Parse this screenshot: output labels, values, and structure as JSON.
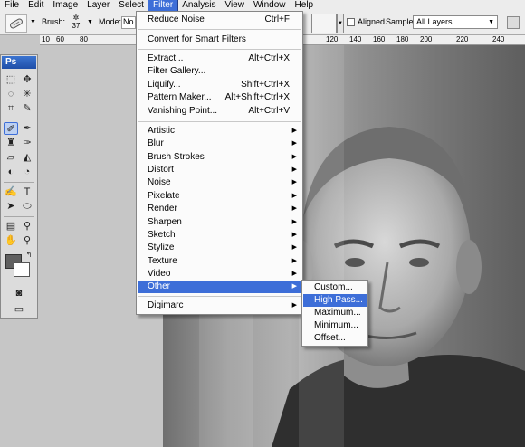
{
  "menubar": {
    "items": [
      "File",
      "Edit",
      "Image",
      "Layer",
      "Select",
      "Filter",
      "Analysis",
      "View",
      "Window",
      "Help"
    ],
    "active": "Filter"
  },
  "options": {
    "brush_label": "Brush:",
    "brush_size": "37",
    "mode_label": "Mode:",
    "mode_value": "No",
    "aligned_label": "Aligned",
    "sample_label": "Sample:",
    "sample_value": "All Layers"
  },
  "ruler": {
    "labels": [
      "10",
      "60",
      "80",
      "120",
      "140",
      "160",
      "180",
      "200",
      "220",
      "240"
    ]
  },
  "toolbox": {
    "logo": "Ps"
  },
  "filter_menu": {
    "top_items": [
      {
        "label": "Reduce Noise",
        "shortcut": "Ctrl+F"
      },
      {
        "label": "Convert for Smart Filters",
        "shortcut": ""
      }
    ],
    "mid_items": [
      {
        "label": "Extract...",
        "shortcut": "Alt+Ctrl+X"
      },
      {
        "label": "Filter Gallery...",
        "shortcut": ""
      },
      {
        "label": "Liquify...",
        "shortcut": "Shift+Ctrl+X"
      },
      {
        "label": "Pattern Maker...",
        "shortcut": "Alt+Shift+Ctrl+X"
      },
      {
        "label": "Vanishing Point...",
        "shortcut": "Alt+Ctrl+V"
      }
    ],
    "submenus": [
      "Artistic",
      "Blur",
      "Brush Strokes",
      "Distort",
      "Noise",
      "Pixelate",
      "Render",
      "Sharpen",
      "Sketch",
      "Stylize",
      "Texture",
      "Video",
      "Other"
    ],
    "highlighted": "Other",
    "bottom_items": [
      "Digimarc"
    ]
  },
  "other_menu": {
    "items": [
      "Custom...",
      "High Pass...",
      "Maximum...",
      "Minimum...",
      "Offset..."
    ],
    "highlighted": "High Pass..."
  },
  "colors": {
    "accent": "#3d6ed8",
    "foreground_swatch": "#606060",
    "background_swatch": "#ffffff"
  }
}
